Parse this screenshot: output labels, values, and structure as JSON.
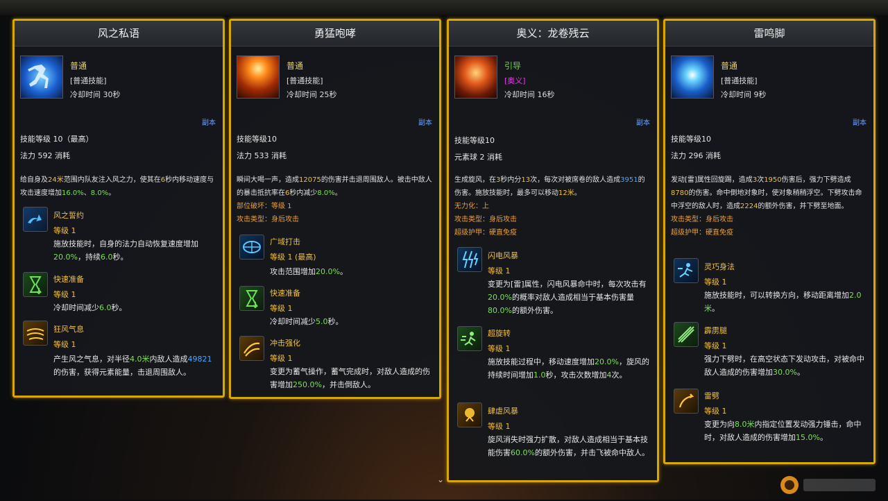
{
  "cards": [
    {
      "title": "风之私语",
      "category": "普通",
      "type": "[普通技能]",
      "cooldown": "冷却时间 30秒",
      "dungeon": "副本",
      "level": "技能等级 10（最高）",
      "mana": "法力 592 消耗",
      "desc1": "给自身及",
      "desc2": "24米",
      "desc3": "范围内队友注入风之力，使其在",
      "desc4": "6",
      "desc5": "秒内移动速度与攻击速度增加",
      "desc6": "16.0%",
      "desc7": "、",
      "desc8": "8.0%",
      "desc9": "。",
      "subs": [
        {
          "name": "风之誓约",
          "level": "等级 1",
          "d1": "施放技能时，自身的法力自动恢复速度增加",
          "d2": "20.0%",
          "d3": "，持续",
          "d4": "6.0",
          "d5": "秒。"
        },
        {
          "name": "快速准备",
          "level": "等级 1",
          "d1": "冷却时间减少",
          "d2": "6.0",
          "d3": "秒。"
        },
        {
          "name": "狂风气息",
          "level": "等级 1",
          "d1": "产生风之气息，对半径",
          "d2": "4.0米",
          "d3": "内敌人造成",
          "d4": "49821",
          "d5": "的伤害，获得元素能量，击退周围敌人。"
        }
      ]
    },
    {
      "title": "勇猛咆哮",
      "category": "普通",
      "type": "[普通技能]",
      "cooldown": "冷却时间 25秒",
      "dungeon": "副本",
      "level": "技能等级10",
      "mana": "法力 533 消耗",
      "desc1": "瞬间大喝一声，造成",
      "desc2": "12075",
      "desc3": "的伤害并击退周围敌人。被击中敌人的暴击抵抗率在",
      "desc4": "6",
      "desc5": "秒内减少",
      "desc6": "8.0%",
      "desc7": "。",
      "prop1": "部位破坏：等级 1",
      "prop2": "攻击类型：身后攻击",
      "subs": [
        {
          "name": "广域打击",
          "level": "等级 1 (最高)",
          "d1": "攻击范围增加",
          "d2": "20.0%",
          "d3": "。"
        },
        {
          "name": "快速准备",
          "level": "等级 1",
          "d1": "冷却时间减少",
          "d2": "5.0",
          "d3": "秒。"
        },
        {
          "name": "冲击强化",
          "level": "等级 1",
          "d1": "变更为蓄气操作，蓄气完成时，对敌人造成的伤害增加",
          "d2": "250.0%",
          "d3": "，并击倒敌人。"
        }
      ]
    },
    {
      "title": "奥义：龙卷残云",
      "category": "引导",
      "type": "[奥义]",
      "cooldown": "冷却时间 16秒",
      "dungeon": "副本",
      "level": "技能等级10",
      "mana": "元素球 2 消耗",
      "desc1": "生成旋风，在",
      "desc2": "3",
      "desc3": "秒内分",
      "desc4": "13",
      "desc5": "次，每次对被席卷的敌人造成",
      "desc6": "3951",
      "desc7": "的伤害。施放技能时，最多可以移动",
      "desc8": "12米",
      "desc9": "。",
      "prop1": "无力化：上",
      "prop2": "攻击类型：身后攻击",
      "prop3": "超级护甲：硬直免疫",
      "subs": [
        {
          "name": "闪电风暴",
          "level": "等级 1",
          "d1": "变更为[雷]属性，闪电风暴命中时，每次攻击有",
          "d2": "20.0%",
          "d3": "的概率对敌人造成相当于基本伤害量",
          "d4": "80.0%",
          "d5": "的额外伤害。"
        },
        {
          "name": "超旋转",
          "level": "等级 1",
          "d1": "施放技能过程中，移动速度增加",
          "d2": "20.0%",
          "d3": "，旋风的持续时间增加",
          "d4": "1.0",
          "d5": "秒，攻击次数增加",
          "d6": "4",
          "d7": "次。"
        },
        {
          "name": "肆虐风暴",
          "level": "等级 1",
          "d1": "旋风消失时强力扩散，对敌人造成相当于基本技能伤害",
          "d2": "60.0%",
          "d3": "的额外伤害，并击飞被命中敌人。"
        }
      ]
    },
    {
      "title": "雷鸣脚",
      "category": "普通",
      "type": "[普通技能]",
      "cooldown": "冷却时间 9秒",
      "dungeon": "副本",
      "level": "技能等级10",
      "mana": "法力 296 消耗",
      "desc1": "发动[雷]属性回旋踢，造成",
      "desc2": "3",
      "desc3": "次",
      "desc4": "1950",
      "desc5": "伤害后，强力下劈造成",
      "desc6": "8780",
      "desc7": "的伤害。命中倒地对象时，使对象稍稍浮空。下劈攻击命中浮空的敌人时，造成",
      "desc8": "2224",
      "desc9": "的额外伤害，并下劈至地面。",
      "prop1": "攻击类型：身后攻击",
      "prop2": "超级护甲：硬直免疫",
      "subs": [
        {
          "name": "灵巧身法",
          "level": "等级 1",
          "d1": "施放技能时，可以转换方向，移动距离增加",
          "d2": "2.0米",
          "d3": "。"
        },
        {
          "name": "霹雳腿",
          "level": "等级 1",
          "d1": "强力下劈时，在高空状态下发动攻击，对被命中敌人造成的伤害增加",
          "d2": "30.0%",
          "d3": "。"
        },
        {
          "name": "雷劈",
          "level": "等级 1",
          "d1": "变更为向",
          "d2": "8.0米",
          "d3": "内指定位置发动强力锤击，命中时，对敌人造成的伤害增加",
          "d4": "15.0%",
          "d5": "。"
        }
      ]
    }
  ]
}
